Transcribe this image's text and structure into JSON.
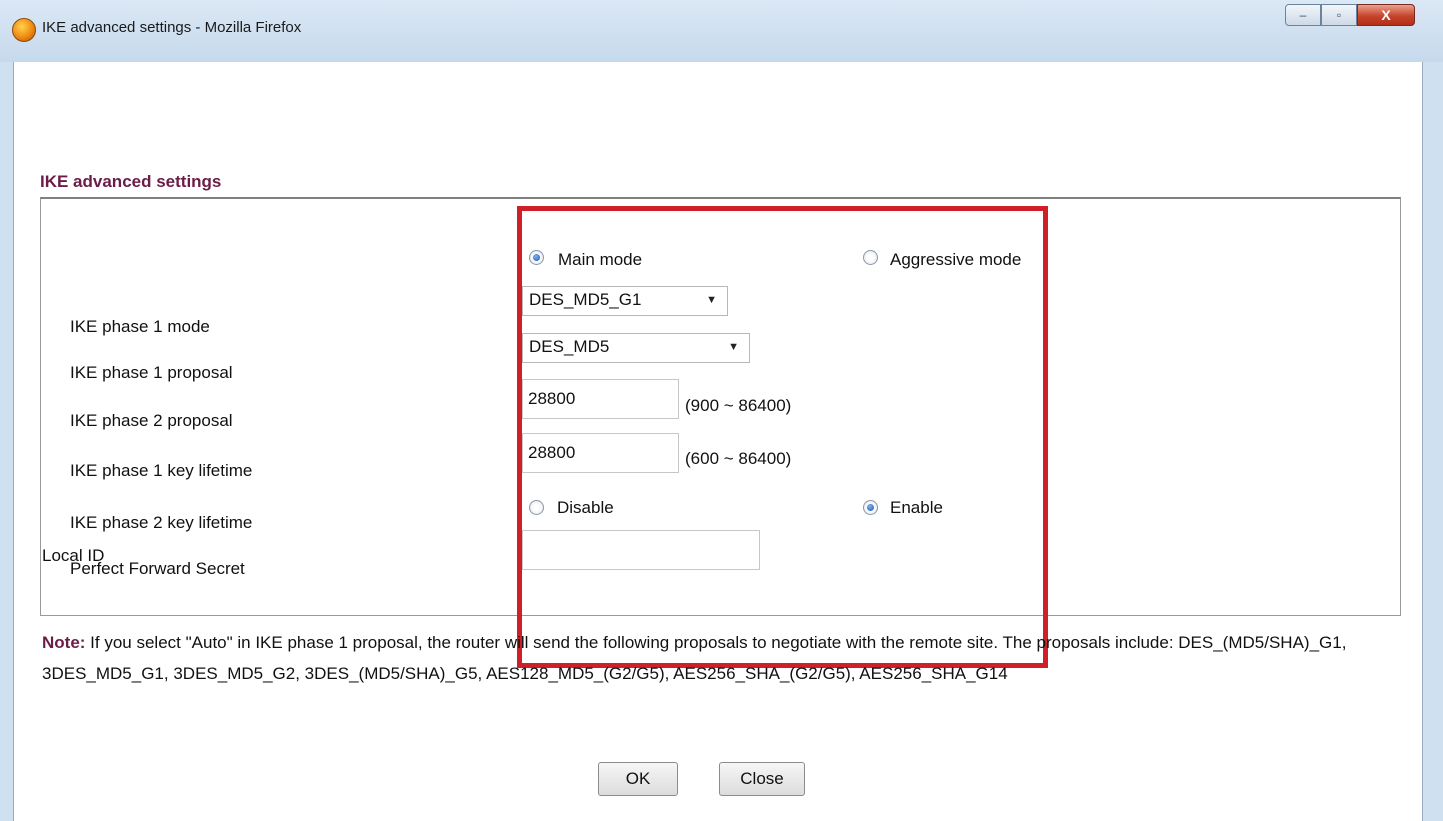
{
  "window": {
    "title": "IKE advanced settings - Mozilla Firefox",
    "minimize": "–",
    "maximize": "▫",
    "close": "X"
  },
  "section": {
    "title": "IKE advanced settings"
  },
  "rows": {
    "phase1_mode": {
      "label": "IKE phase 1 mode",
      "options": [
        "Main mode",
        "Aggressive mode"
      ],
      "selected": "Main mode"
    },
    "phase1_proposal": {
      "label": "IKE phase 1 proposal",
      "value": "DES_MD5_G1"
    },
    "phase2_proposal": {
      "label": "IKE phase 2 proposal",
      "value": "DES_MD5"
    },
    "phase1_lifetime": {
      "label": "IKE phase 1 key lifetime",
      "value": "28800",
      "range": "(900 ~ 86400)"
    },
    "phase2_lifetime": {
      "label": "IKE phase 2 key lifetime",
      "value": "28800",
      "range": "(600 ~ 86400)"
    },
    "pfs": {
      "label": "Perfect Forward Secret",
      "options": [
        "Disable",
        "Enable"
      ],
      "selected": "Enable"
    },
    "local_id": {
      "label": "Local ID",
      "value": ""
    }
  },
  "note": {
    "prefix": "Note:",
    "text": " If you select \"Auto\" in IKE phase 1 proposal, the router will send the following proposals to negotiate with the remote site. The proposals include: DES_(MD5/SHA)_G1, 3DES_MD5_G1, 3DES_MD5_G2, 3DES_(MD5/SHA)_G5, AES128_MD5_(G2/G5), AES256_SHA_(G2/G5), AES256_SHA_G14"
  },
  "buttons": {
    "ok": "OK",
    "close": "Close"
  },
  "colors": {
    "highlight": "#d02027",
    "title_accent": "#6b1d47"
  }
}
